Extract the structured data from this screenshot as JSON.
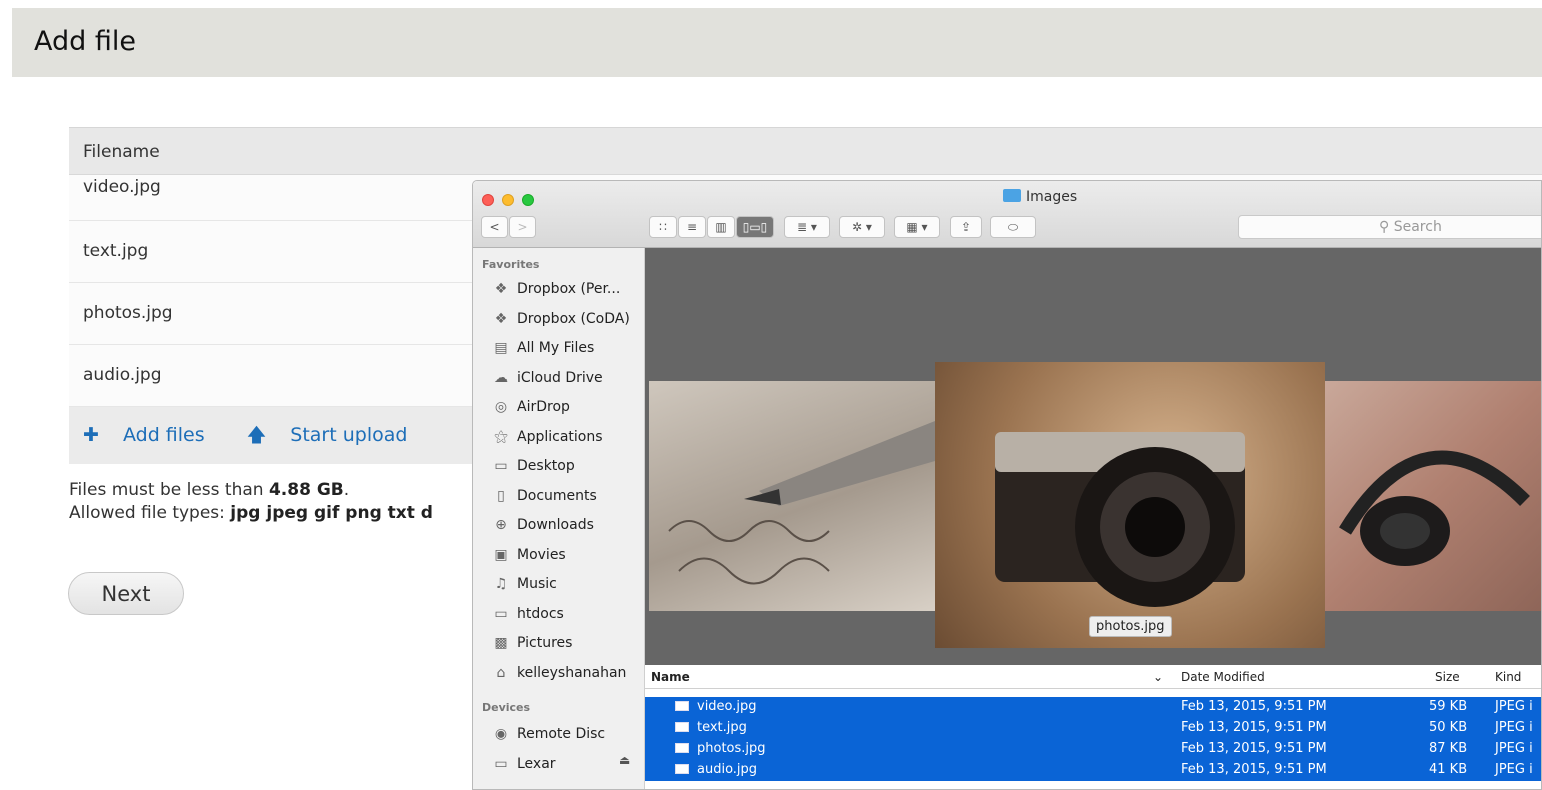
{
  "header": {
    "title": "Add file"
  },
  "table": {
    "column": "Filename",
    "rows": [
      "video.jpg",
      "text.jpg",
      "photos.jpg",
      "audio.jpg"
    ],
    "add_files": "Add files",
    "start_upload": "Start upload"
  },
  "note": {
    "size_prefix": "Files must be less than",
    "size_value": "4.88 GB",
    "size_suffix": ".",
    "types_prefix": "Allowed file types:",
    "types_value": "jpg jpeg gif png txt d"
  },
  "next_label": "Next",
  "finder": {
    "title": "Images",
    "search_placeholder": "Search",
    "sections": {
      "favorites": "Favorites",
      "devices": "Devices"
    },
    "favorites": [
      {
        "label": "Dropbox (Per...",
        "icon": "dropbox-icon"
      },
      {
        "label": "Dropbox (CoDA)",
        "icon": "dropbox-icon"
      },
      {
        "label": "All My Files",
        "icon": "all-files-icon"
      },
      {
        "label": "iCloud Drive",
        "icon": "cloud-icon"
      },
      {
        "label": "AirDrop",
        "icon": "airdrop-icon"
      },
      {
        "label": "Applications",
        "icon": "applications-icon"
      },
      {
        "label": "Desktop",
        "icon": "desktop-icon"
      },
      {
        "label": "Documents",
        "icon": "documents-icon"
      },
      {
        "label": "Downloads",
        "icon": "downloads-icon"
      },
      {
        "label": "Movies",
        "icon": "movies-icon"
      },
      {
        "label": "Music",
        "icon": "music-icon"
      },
      {
        "label": "htdocs",
        "icon": "folder-icon"
      },
      {
        "label": "Pictures",
        "icon": "pictures-icon"
      },
      {
        "label": "kelleyshanahan",
        "icon": "home-icon"
      }
    ],
    "devices": [
      {
        "label": "Remote Disc",
        "icon": "disc-icon"
      },
      {
        "label": "Lexar",
        "icon": "drive-icon"
      }
    ],
    "preview_caption": "photos.jpg",
    "columns": {
      "name": "Name",
      "date": "Date Modified",
      "size": "Size",
      "kind": "Kind"
    },
    "files": [
      {
        "name": "video.jpg",
        "date": "Feb 13, 2015, 9:51 PM",
        "size": "59 KB",
        "kind": "JPEG i"
      },
      {
        "name": "text.jpg",
        "date": "Feb 13, 2015, 9:51 PM",
        "size": "50 KB",
        "kind": "JPEG i"
      },
      {
        "name": "photos.jpg",
        "date": "Feb 13, 2015, 9:51 PM",
        "size": "87 KB",
        "kind": "JPEG i"
      },
      {
        "name": "audio.jpg",
        "date": "Feb 13, 2015, 9:51 PM",
        "size": "41 KB",
        "kind": "JPEG i"
      }
    ]
  }
}
